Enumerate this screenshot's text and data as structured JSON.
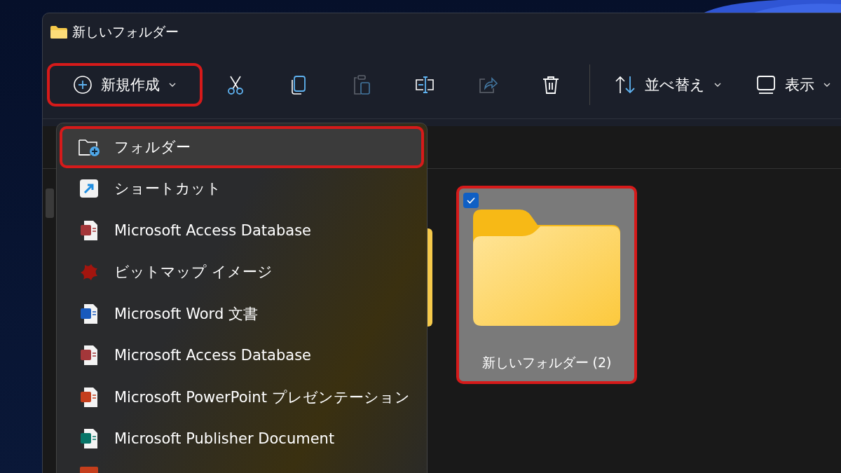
{
  "window": {
    "title": "新しいフォルダー"
  },
  "toolbar": {
    "new_button": {
      "label": "新規作成",
      "highlighted": true
    },
    "icon_buttons": [
      {
        "kind": "cut",
        "disabled": false
      },
      {
        "kind": "copy",
        "disabled": false
      },
      {
        "kind": "paste",
        "disabled": true
      },
      {
        "kind": "rename",
        "disabled": false
      },
      {
        "kind": "share",
        "disabled": true
      },
      {
        "kind": "delete",
        "disabled": false
      }
    ],
    "sort_button": {
      "label": "並べ替え"
    },
    "view_button": {
      "label": "表示"
    }
  },
  "new_menu": {
    "items": [
      {
        "kind": "folder",
        "label": "フォルダー",
        "highlighted": true
      },
      {
        "kind": "shortcut",
        "label": "ショートカット",
        "highlighted": false
      },
      {
        "kind": "access",
        "label": "Microsoft Access Database",
        "highlighted": false
      },
      {
        "kind": "bitmap",
        "label": "ビットマップ イメージ",
        "highlighted": false
      },
      {
        "kind": "word",
        "label": "Microsoft Word 文書",
        "highlighted": false
      },
      {
        "kind": "access-old",
        "label": "Microsoft Access Database",
        "highlighted": false
      },
      {
        "kind": "powerpoint",
        "label": "Microsoft PowerPoint プレゼンテーション",
        "highlighted": false
      },
      {
        "kind": "publisher",
        "label": "Microsoft Publisher Document",
        "highlighted": false
      },
      {
        "kind": "partial"
      }
    ]
  },
  "files": [
    {
      "name": "新しいフォルダー (2)",
      "selected": true,
      "highlighted": true
    }
  ]
}
